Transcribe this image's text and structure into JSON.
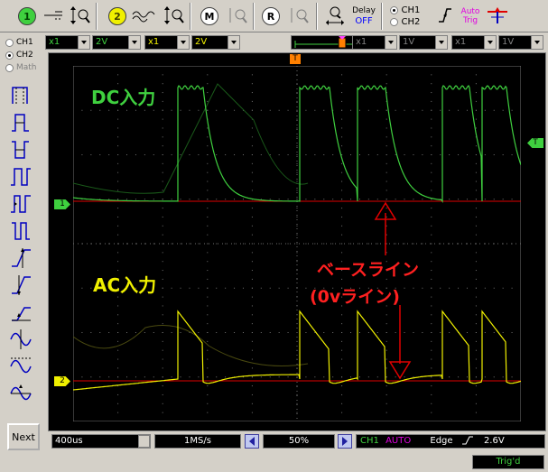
{
  "toolbar": {
    "ch1_button": "1",
    "ch2_button": "2",
    "math_button": "M",
    "ref_button": "R",
    "delay_label": "Delay",
    "delay_value": "OFF",
    "trig_ch1": "CH1",
    "trig_ch2": "CH2",
    "auto_label": "Auto",
    "trig_label": "Trig"
  },
  "settings": {
    "ch1_probe": "x1",
    "ch1_volts": "2V",
    "ch2_probe": "x1",
    "ch2_volts": "2V",
    "math_probe": "x1",
    "math_volts": "1V",
    "ref_probe": "x1",
    "ref_volts": "1V",
    "trigger_marker": "T"
  },
  "sidebar": {
    "ch1": "CH1",
    "ch2": "CH2",
    "math": "Math",
    "next_button": "Next"
  },
  "scope": {
    "dc_label": "DC入力",
    "ac_label": "AC入力",
    "baseline_line1": "ベースライン",
    "baseline_line2": "(0vライン)",
    "ch1_marker": "1",
    "ch2_marker": "2",
    "trig_level_marker": "T",
    "colors": {
      "ch1": "#3fd03f",
      "ch2": "#f0f000",
      "baseline": "#e00000",
      "annotation": "#ff2020",
      "grid": "#707070"
    }
  },
  "bottom": {
    "timebase": "400us",
    "sample_rate": "1MS/s",
    "position": "50%",
    "trig_source": "CH1",
    "trig_mode": "AUTO",
    "trig_type": "Edge",
    "trig_level": "2.6V",
    "status": "Trig'd"
  }
}
